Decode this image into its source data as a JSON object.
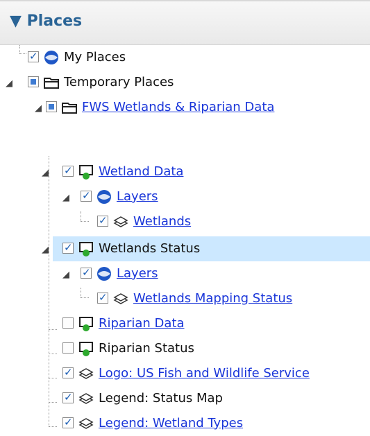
{
  "panel": {
    "title": "Places"
  },
  "items": [
    {
      "label": "My Places"
    },
    {
      "label": "Temporary Places"
    },
    {
      "label": "FWS Wetlands & Riparian Data"
    },
    {
      "label": "Wetland Data"
    },
    {
      "label": "Layers"
    },
    {
      "label": "Wetlands"
    },
    {
      "label": "Wetlands Status"
    },
    {
      "label": "Layers"
    },
    {
      "label": "Wetlands Mapping Status"
    },
    {
      "label": "Riparian Data"
    },
    {
      "label": "Riparian Status"
    },
    {
      "label": "Logo: US Fish and Wildlife Service"
    },
    {
      "label": "Legend: Status Map"
    },
    {
      "label": "Legend: Wetland Types"
    }
  ],
  "colors": {
    "link": "#1a36d9",
    "selected_row": "#cce8ff",
    "header_title": "#2a6496"
  },
  "icons": [
    "globe-icon",
    "folder-icon",
    "network-link-icon",
    "layer-stack-icon"
  ]
}
